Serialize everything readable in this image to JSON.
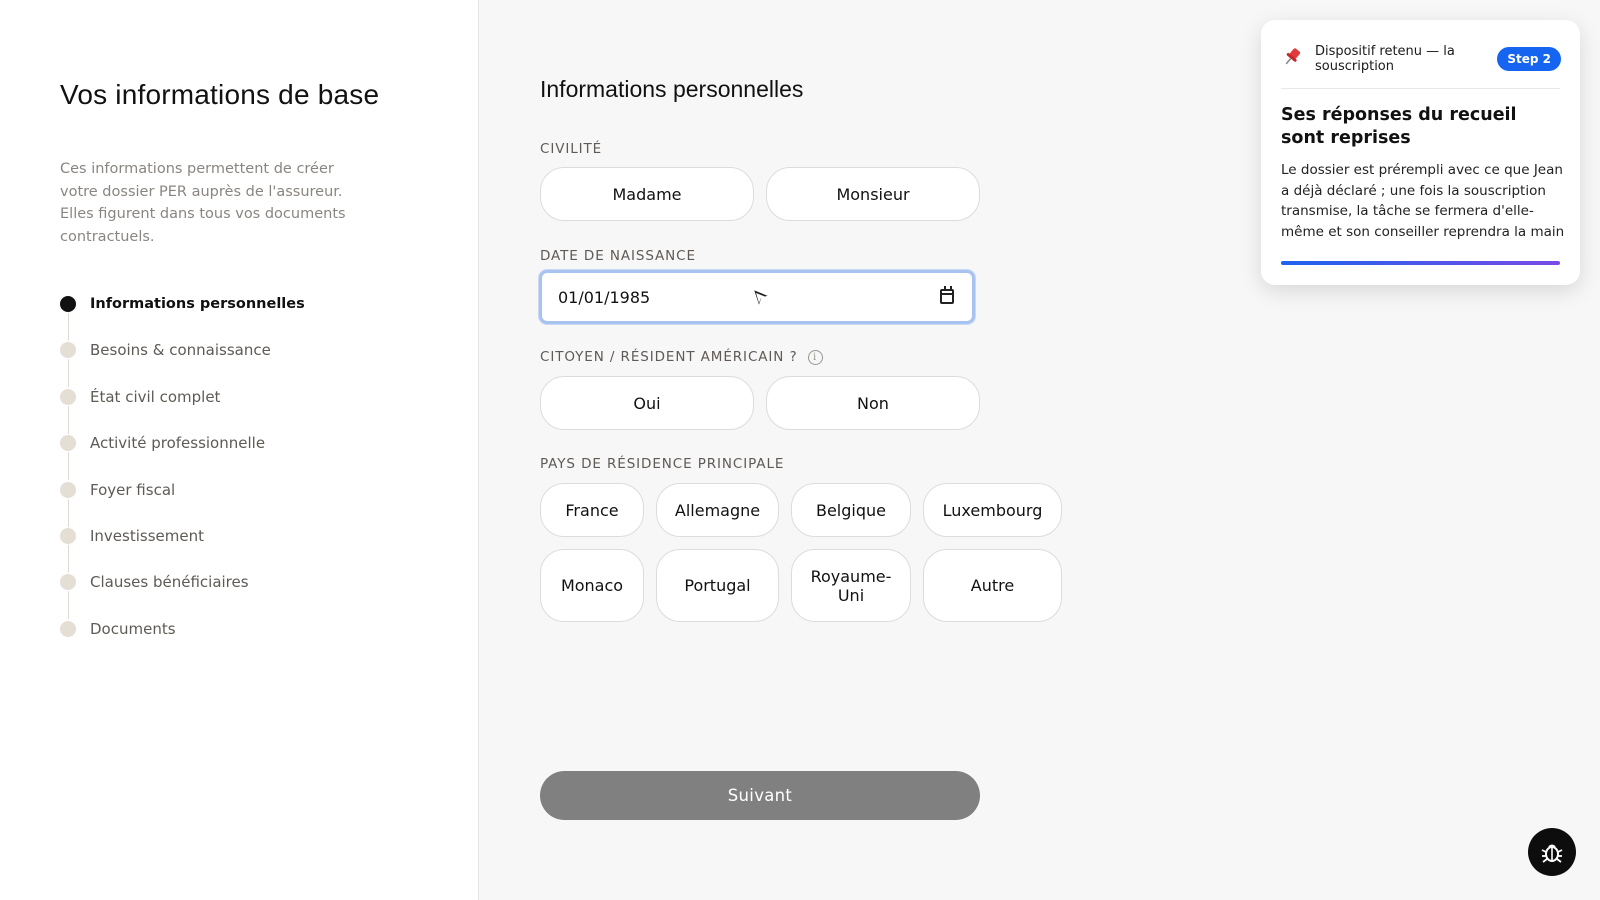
{
  "sidebar": {
    "title": "Vos informations de base",
    "description": "Ces informations permettent de créer votre dossier PER auprès de l'assureur. Elles figurent dans tous vos documents contractuels.",
    "steps": [
      {
        "label": "Informations personnelles",
        "active": true
      },
      {
        "label": "Besoins & connaissance",
        "active": false
      },
      {
        "label": "État civil complet",
        "active": false
      },
      {
        "label": "Activité professionnelle",
        "active": false
      },
      {
        "label": "Foyer fiscal",
        "active": false
      },
      {
        "label": "Investissement",
        "active": false
      },
      {
        "label": "Clauses bénéficiaires",
        "active": false
      },
      {
        "label": "Documents",
        "active": false
      }
    ]
  },
  "form": {
    "title": "Informations personnelles",
    "civility": {
      "label": "CIVILITÉ",
      "options": [
        "Madame",
        "Monsieur"
      ]
    },
    "birthdate": {
      "label": "DATE DE NAISSANCE",
      "value": "01/01/1985"
    },
    "us_citizen": {
      "label": "CITOYEN / RÉSIDENT AMÉRICAIN ?",
      "info_glyph": "i",
      "options": [
        "Oui",
        "Non"
      ]
    },
    "country": {
      "label": "PAYS DE RÉSIDENCE PRINCIPALE",
      "options": [
        "France",
        "Allemagne",
        "Belgique",
        "Luxembourg",
        "Monaco",
        "Portugal",
        "Royaume-Uni",
        "Autre"
      ]
    },
    "submit_label": "Suivant"
  },
  "guide_card": {
    "icon": "pushpin-icon",
    "heading": "Dispositif retenu — la souscription",
    "badge": "Step 2",
    "title": "Ses réponses du recueil sont reprises",
    "body": "Le dossier est prérempli avec ce que Jean a déjà déclaré ; une fois la souscription transmise, la tâche se fermera d'elle-même et son conseiller reprendra la main",
    "progress": 1.0
  },
  "colors": {
    "accent": "#1565f0",
    "submit_bg": "#808080",
    "focus_ring": "#a8c3f0"
  }
}
